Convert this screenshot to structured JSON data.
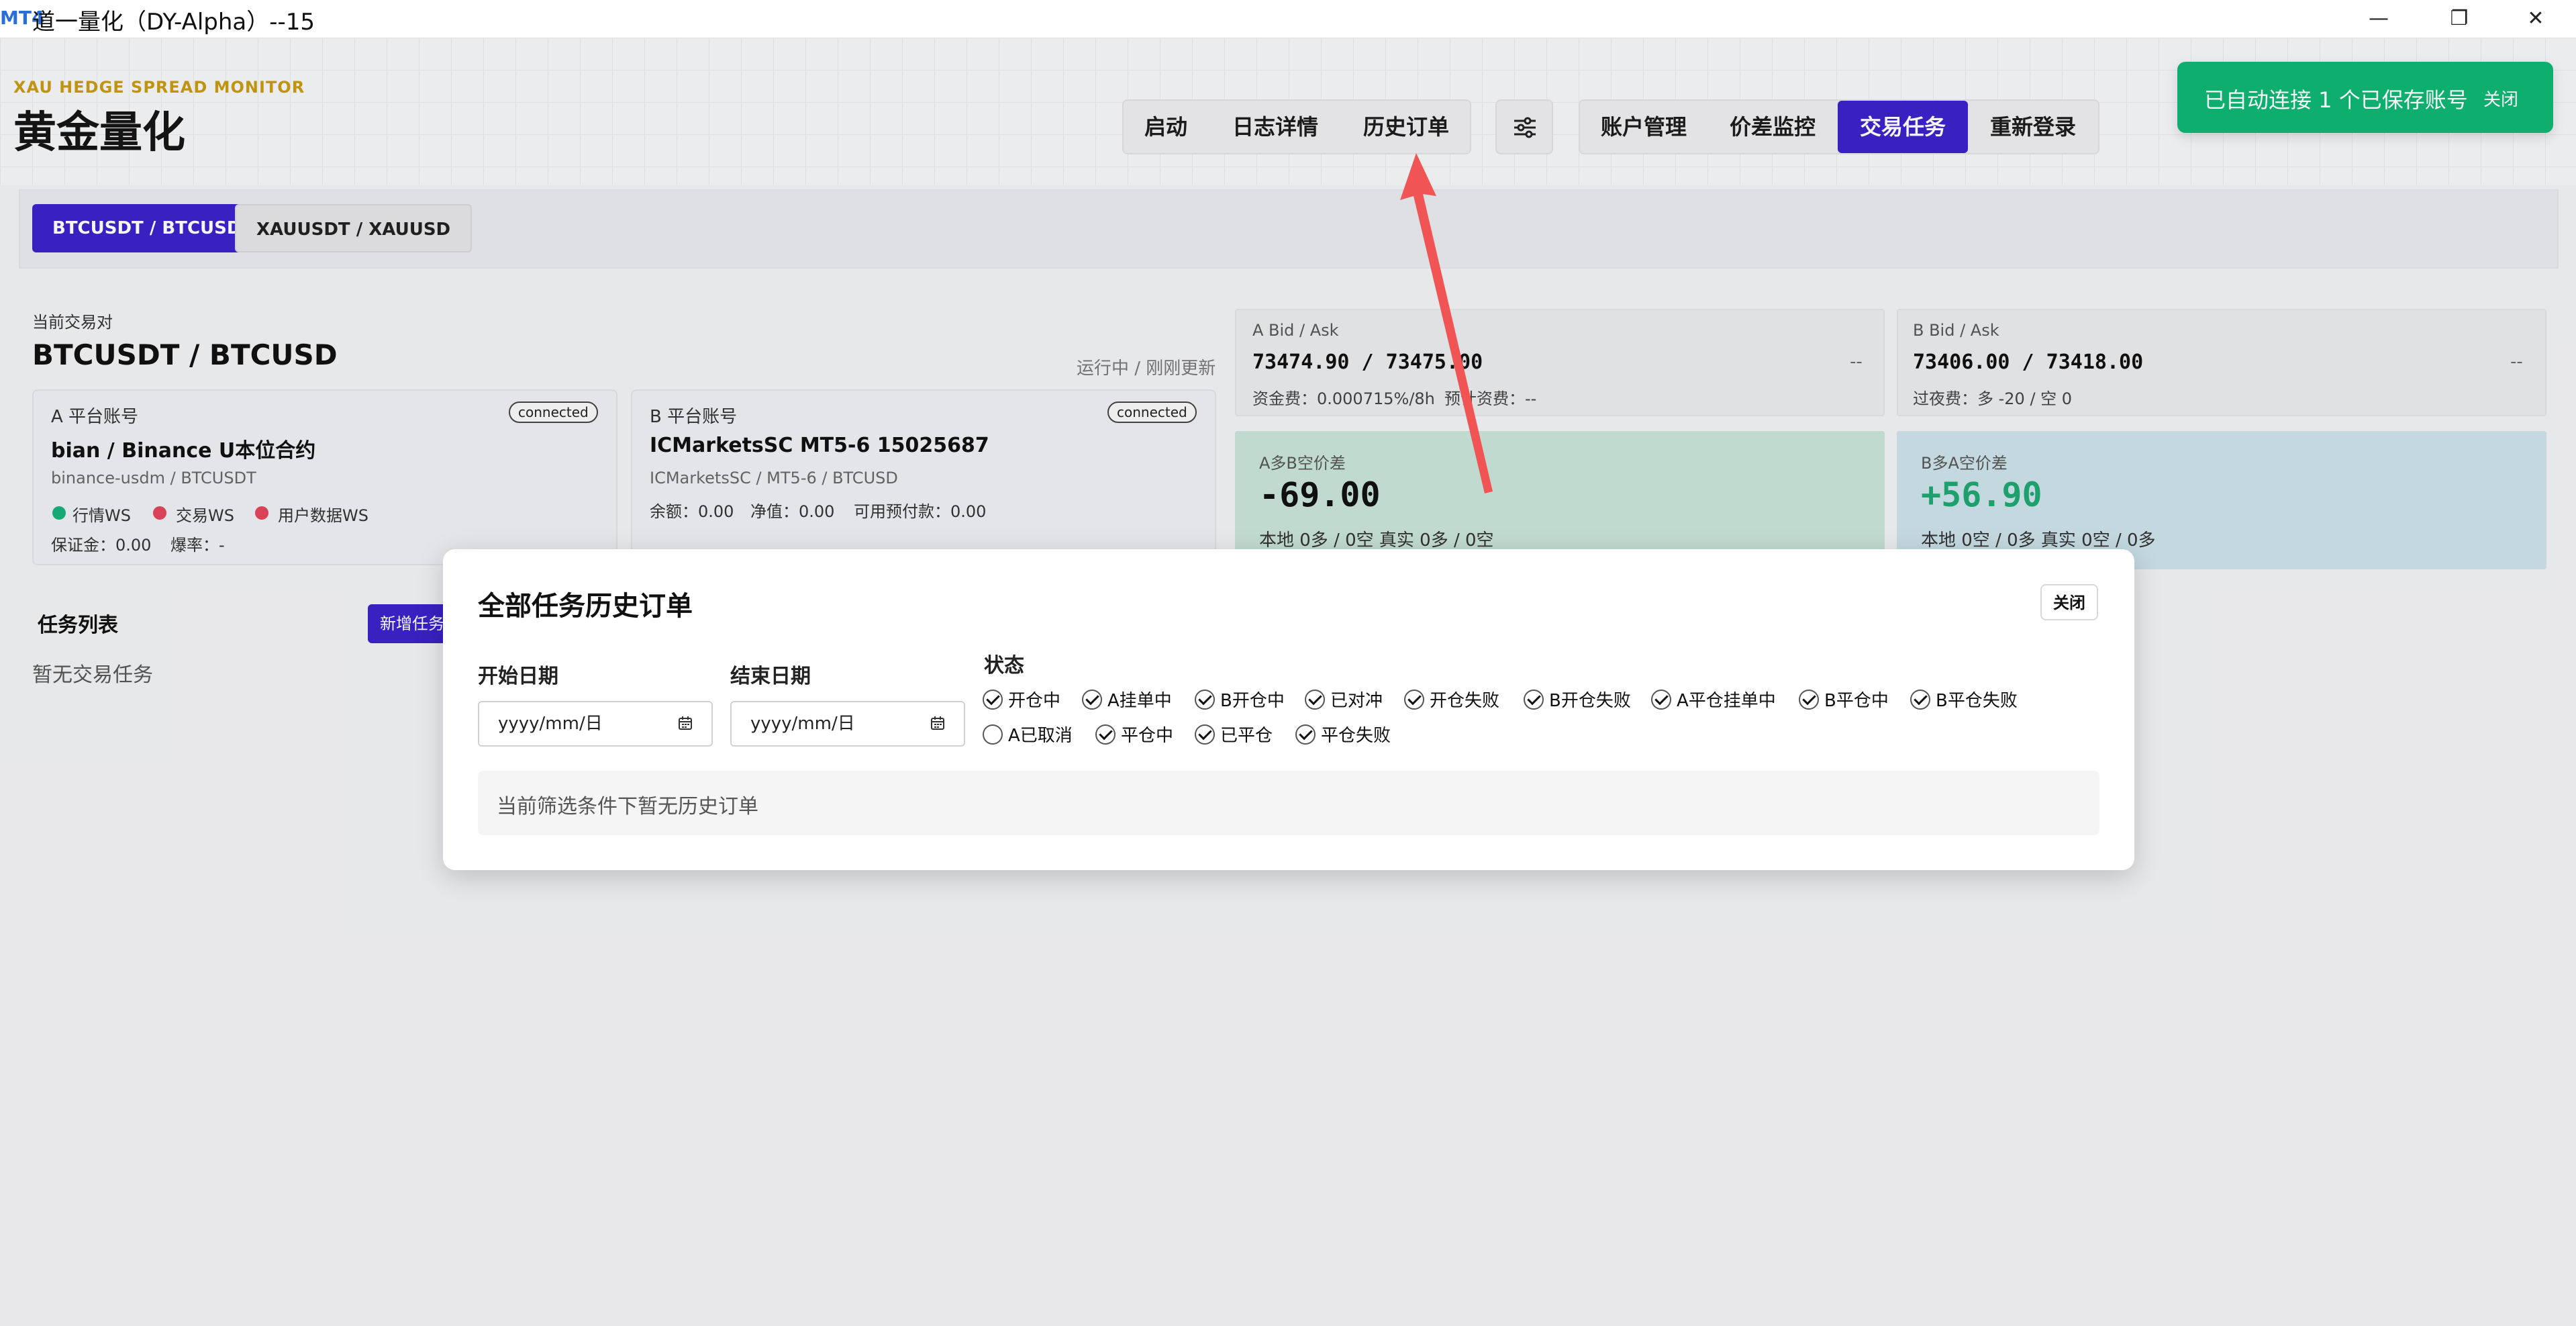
{
  "window": {
    "logo_text": "MT4",
    "title": "道一量化（DY-Alpha）--15",
    "controls": {
      "minimize": "—",
      "restore": "❐",
      "close": "✕"
    }
  },
  "brand": {
    "subtitle": "XAU HEDGE SPREAD MONITOR",
    "title": "黄金量化"
  },
  "nav": {
    "start": "启动",
    "logs": "日志详情",
    "history": "历史订单",
    "accounts": "账户管理",
    "spread_monitor": "价差监控",
    "trade_tasks": "交易任务",
    "relogin": "重新登录"
  },
  "toast": {
    "message": "已自动连接 1 个已保存账号",
    "close": "关闭"
  },
  "pairs": {
    "active": "BTCUSDT / BTCUSD",
    "other": "XAUUSDT / XAUUSD"
  },
  "current": {
    "label": "当前交易对",
    "pair": "BTCUSDT / BTCUSD",
    "status": "运行中 / 刚刚更新"
  },
  "account_a": {
    "label": "A 平台账号",
    "badge": "connected",
    "name": "bian / Binance U本位合约",
    "sub": "binance-usdm / BTCUSDT",
    "ws": [
      "行情WS",
      "交易WS",
      "用户数据WS"
    ],
    "ws_colors": [
      "#17b07a",
      "#e0465e",
      "#e0465e"
    ],
    "margin": "保证金：0.00",
    "burst": "爆率：-"
  },
  "account_b": {
    "label": "B 平台账号",
    "badge": "connected",
    "name": "ICMarketsSC MT5-6 15025687",
    "sub": "ICMarketsSC / MT5-6 / BTCUSD",
    "balance": "余额：0.00",
    "equity": "净值：0.00",
    "available": "可用预付款：0.00"
  },
  "quote_a": {
    "label": "A Bid / Ask",
    "value": "73474.90 / 73475.00",
    "dash": "--",
    "fee": "资金费：0.000715%/8h",
    "predicted": "预计资费：--"
  },
  "quote_b": {
    "label": "B Bid / Ask",
    "value": "73406.00 / 73418.00",
    "dash": "--",
    "swap": "过夜费：多 -20 / 空 0"
  },
  "spread_a": {
    "label": "A多B空价差",
    "value": "-69.00",
    "color": "#111111",
    "sub": "本地 0多 / 0空 真实 0多 / 0空"
  },
  "spread_b": {
    "label": "B多A空价差",
    "value": "+56.90",
    "color": "#1fa66f",
    "sub": "本地 0空 / 0多 真实 0空 / 0多"
  },
  "tasks": {
    "title": "任务列表",
    "new_button": "新增任务",
    "empty": "暂无交易任务"
  },
  "modal": {
    "title": "全部任务历史订单",
    "close": "关闭",
    "start_date_label": "开始日期",
    "end_date_label": "结束日期",
    "date_placeholder": "yyyy/mm/日",
    "status_label": "状态",
    "statuses_row1": [
      {
        "label": "开仓中",
        "checked": true
      },
      {
        "label": "A挂单中",
        "checked": true
      },
      {
        "label": "B开仓中",
        "checked": true
      },
      {
        "label": "已对冲",
        "checked": true
      },
      {
        "label": "开仓失败",
        "checked": true
      },
      {
        "label": "B开仓失败",
        "checked": true
      },
      {
        "label": "A平仓挂单中",
        "checked": true
      },
      {
        "label": "B平仓中",
        "checked": true
      },
      {
        "label": "B平仓失败",
        "checked": true
      }
    ],
    "statuses_row2": [
      {
        "label": "A已取消",
        "checked": false
      },
      {
        "label": "平仓中",
        "checked": true
      },
      {
        "label": "已平仓",
        "checked": true
      },
      {
        "label": "平仓失败",
        "checked": true
      }
    ],
    "empty": "当前筛选条件下暂无历史订单"
  },
  "colors": {
    "accent": "#3b22c9",
    "toast": "#0fb574",
    "annotation_arrow": "#f05454"
  }
}
